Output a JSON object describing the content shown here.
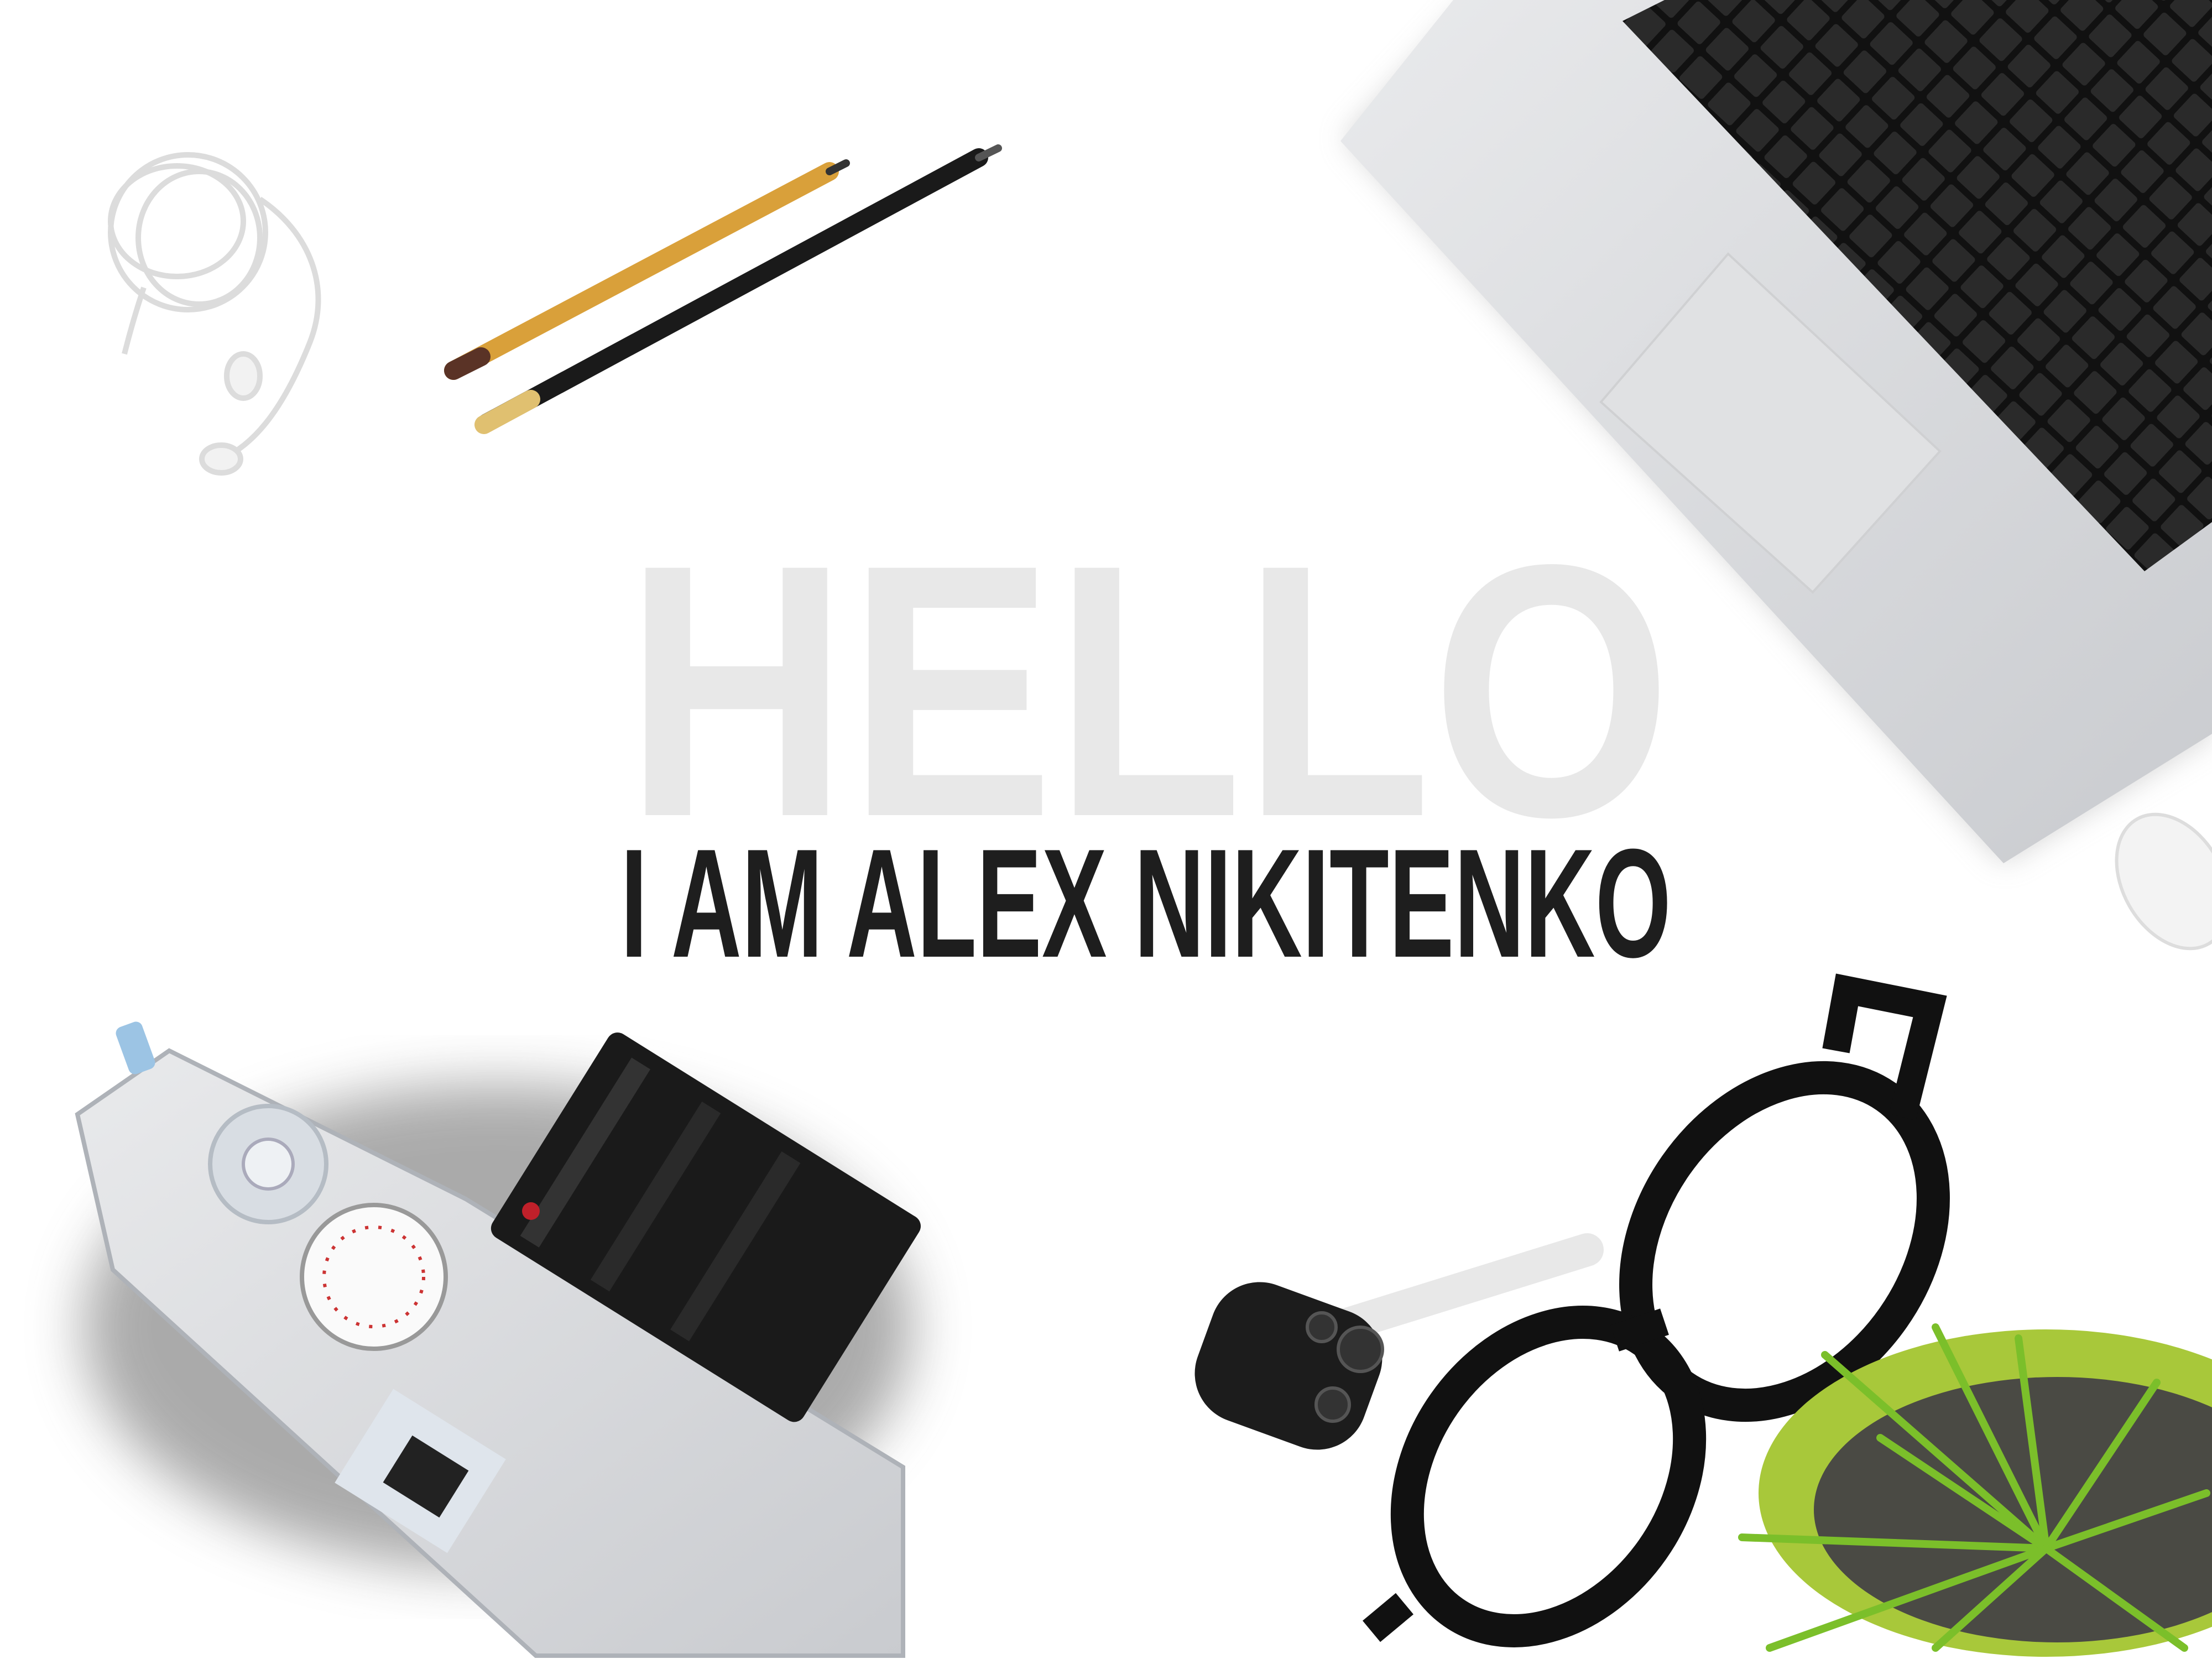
{
  "hero": {
    "greeting": "HELLO",
    "intro": "I AM ALEX NIKITENKO"
  },
  "colors": {
    "background": "#ffffff",
    "greeting": "#e8e8e8",
    "intro": "#1e1e1e",
    "plant_pot": "#a8c83a"
  }
}
